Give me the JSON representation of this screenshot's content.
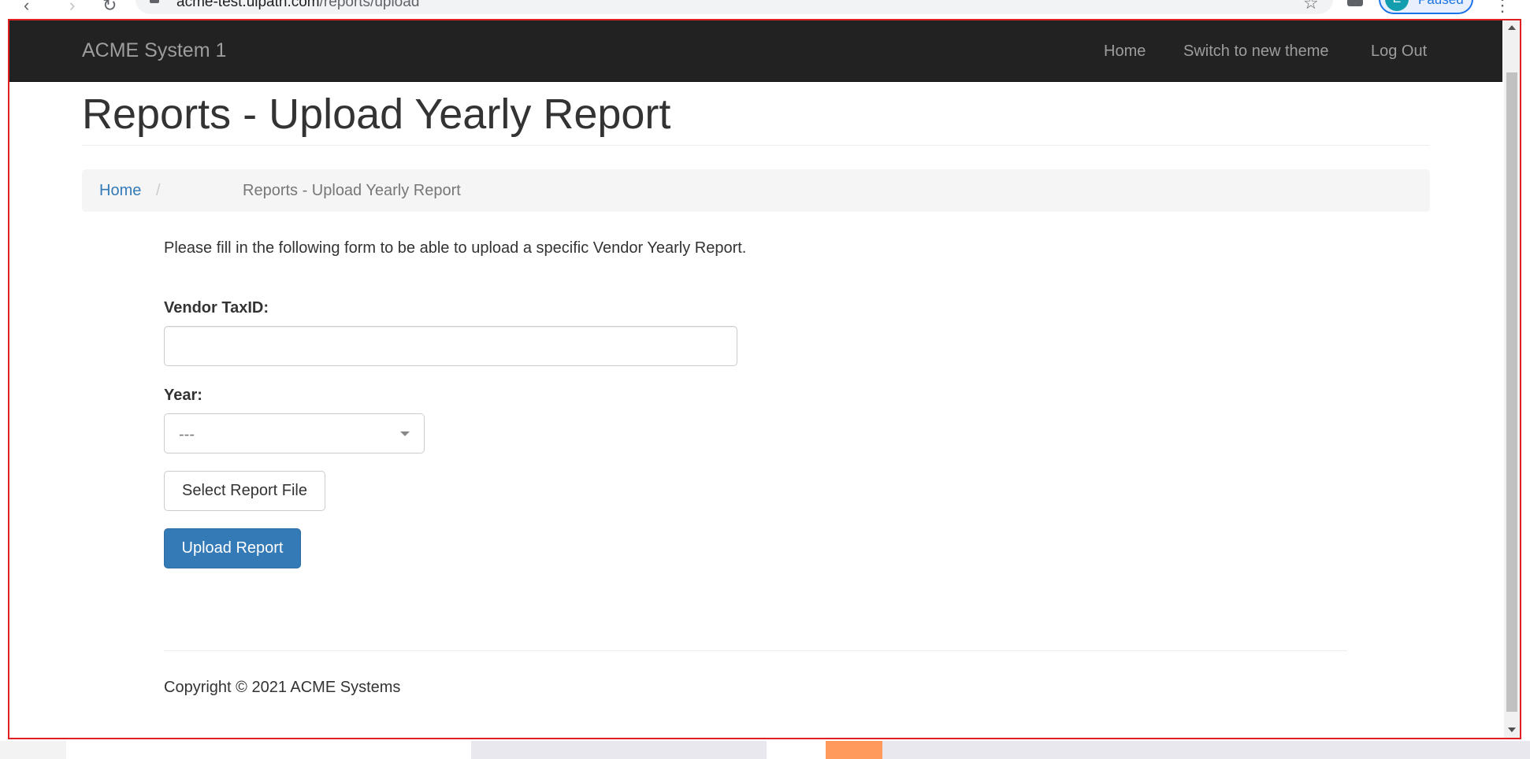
{
  "browser": {
    "url_host": "acme-test.uipath.com",
    "url_path": "/reports/upload",
    "profile_initial": "E",
    "profile_status": "Paused"
  },
  "navbar": {
    "brand": "ACME System 1",
    "links": [
      {
        "label": "Home"
      },
      {
        "label": "Switch to new theme"
      },
      {
        "label": "Log Out"
      }
    ]
  },
  "page": {
    "title": "Reports - Upload Yearly Report"
  },
  "breadcrumb": {
    "home": "Home",
    "separator": "/",
    "current": "Reports - Upload Yearly Report"
  },
  "form": {
    "intro": "Please fill in the following form to be able to upload a specific Vendor Yearly Report.",
    "vendor_taxid_label": "Vendor TaxID:",
    "vendor_taxid_value": "",
    "year_label": "Year:",
    "year_selected": "---",
    "select_file_label": "Select Report File",
    "upload_label": "Upload Report"
  },
  "footer": {
    "copyright": "Copyright © 2021 ACME Systems"
  },
  "colors": {
    "navbar_bg": "#222222",
    "navbar_text": "#9d9d9d",
    "link": "#337ab7",
    "primary_button": "#337ab7",
    "frame_border": "#e02020"
  }
}
